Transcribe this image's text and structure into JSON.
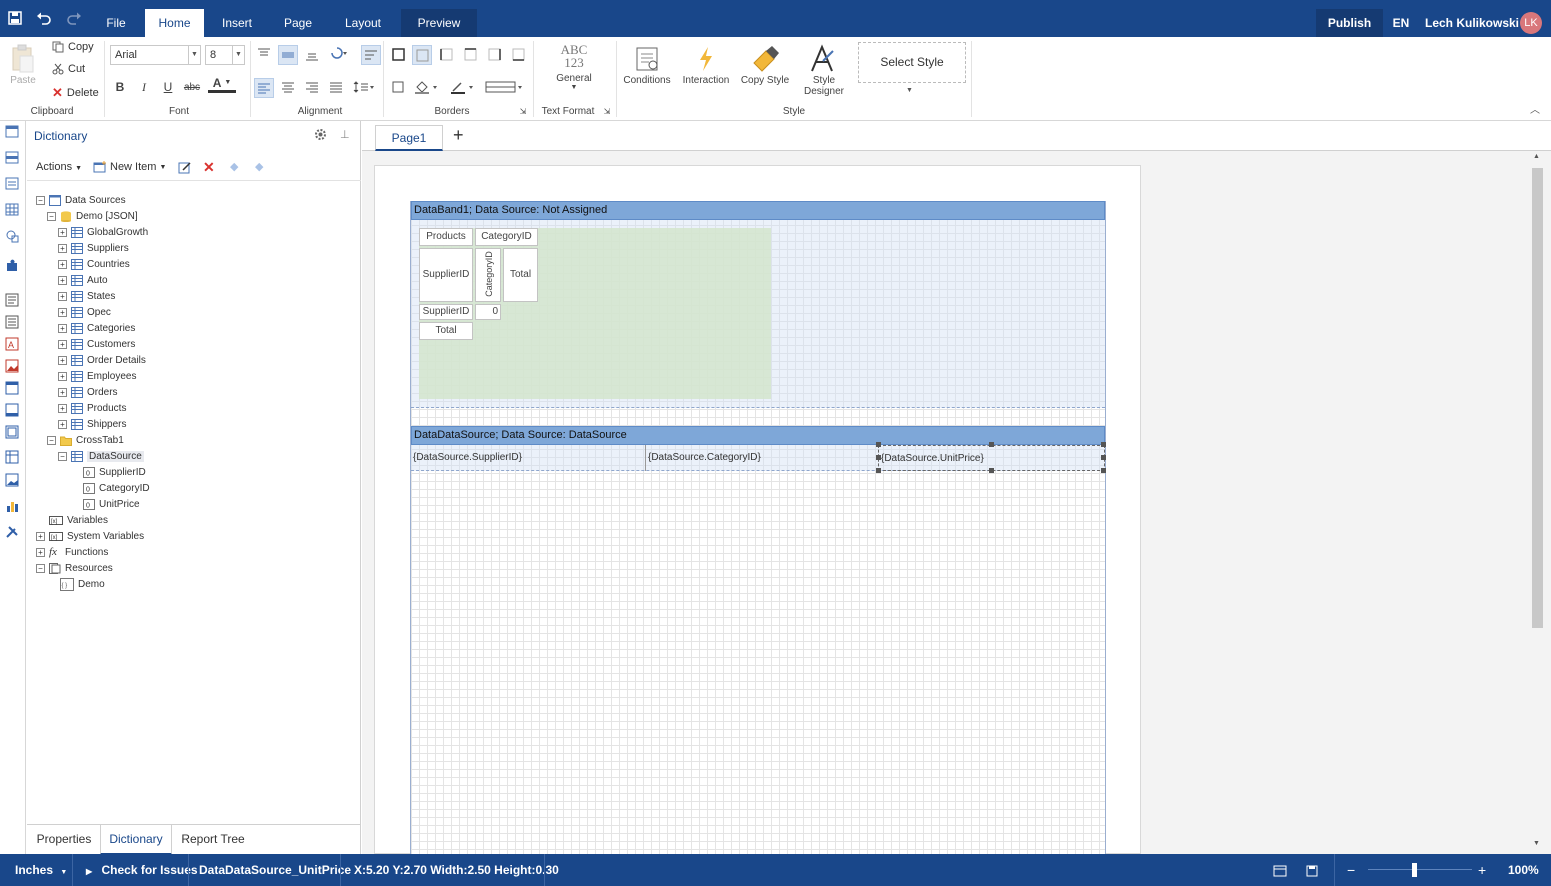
{
  "topbar": {
    "menu_tabs": [
      "File",
      "Home",
      "Insert",
      "Page",
      "Layout",
      "Preview"
    ],
    "active_tab": "Home",
    "publish_label": "Publish",
    "language": "EN",
    "user_name": "Lech Kulikowski",
    "user_initials": "LK",
    "colors": {
      "bar": "#19478a",
      "avatar": "#d9777b"
    }
  },
  "ribbon": {
    "clipboard": {
      "paste": "Paste",
      "copy": "Copy",
      "cut": "Cut",
      "delete": "Delete",
      "label": "Clipboard"
    },
    "font": {
      "family": "Arial",
      "size": "8",
      "label": "Font",
      "bold": "B",
      "italic": "I",
      "underline": "U",
      "strike": "abc",
      "color_letter": "A"
    },
    "alignment": {
      "label": "Alignment"
    },
    "borders": {
      "label": "Borders"
    },
    "text_format": {
      "label": "Text Format",
      "abc": "ABC",
      "digits": "123",
      "general": "General"
    },
    "style": {
      "label": "Style",
      "conditions": "Conditions",
      "interaction": "Interaction",
      "copy_style": "Copy Style",
      "style_designer_1": "Style",
      "style_designer_2": "Designer",
      "select_style": "Select Style"
    }
  },
  "dictionary": {
    "title": "Dictionary",
    "actions_label": "Actions",
    "new_item_label": "New Item",
    "tree": {
      "data_sources": "Data Sources",
      "demo_json": "Demo [JSON]",
      "tables": [
        "GlobalGrowth",
        "Suppliers",
        "Countries",
        "Auto",
        "States",
        "Opec",
        "Categories",
        "Customers",
        "Order Details",
        "Employees",
        "Orders",
        "Products",
        "Shippers"
      ],
      "crosstab": "CrossTab1",
      "datasource": "DataSource",
      "columns": [
        "SupplierID",
        "CategoryID",
        "UnitPrice"
      ],
      "variables": "Variables",
      "system_variables": "System Variables",
      "functions": "Functions",
      "resources": "Resources",
      "resource_demo": "Demo"
    },
    "bottom_tabs": [
      "Properties",
      "Dictionary",
      "Report Tree"
    ],
    "active_bottom_tab": "Dictionary"
  },
  "designer": {
    "page_tab": "Page1",
    "add_page": "+",
    "band1_header": "DataBand1; Data Source: Not Assigned",
    "crosstab": {
      "products": "Products",
      "categoryid": "CategoryID",
      "supplierid": "SupplierID",
      "categoryid_vertical": "CategoryID",
      "total": "Total",
      "supplierid_row": "SupplierID",
      "zero": "0",
      "total_row": "Total"
    },
    "band2_header": "DataDataSource; Data Source: DataSource",
    "fields": [
      "{DataSource.SupplierID}",
      "{DataSource.CategoryID}",
      "{DataSource.UnitPrice}"
    ],
    "colors": {
      "band_header": "#7ea7d8",
      "crosstab_area": "#d4e5cc"
    }
  },
  "status": {
    "units": "Inches",
    "check_issues": "Check for Issues",
    "selected_component": "DataDataSource_UnitPrice",
    "position": "X:5.20 Y:2.70 Width:2.50 Height:0.30",
    "zoom": "100%",
    "zoom_minus": "−",
    "zoom_plus": "+"
  }
}
